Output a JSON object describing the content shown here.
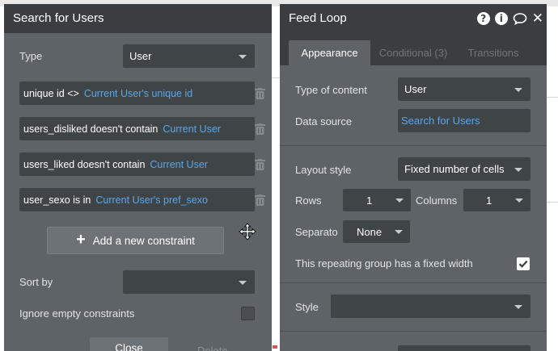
{
  "search_panel": {
    "title": "Search for Users",
    "type_label": "Type",
    "type_value": "User",
    "constraints": [
      {
        "field": "unique id <>",
        "value": "Current User's unique id"
      },
      {
        "field": "users_disliked doesn't contain",
        "value": "Current User"
      },
      {
        "field": "users_liked doesn't contain",
        "value": "Current User"
      },
      {
        "field": "user_sexo is in",
        "value": "Current User's pref_sexo"
      }
    ],
    "add_constraint_label": "Add a new constraint",
    "sort_by_label": "Sort by",
    "sort_by_value": "",
    "ignore_empty_label": "Ignore empty constraints",
    "close_label": "Close",
    "delete_label": "Delete"
  },
  "feed_panel": {
    "title": "Feed Loop",
    "tabs": [
      {
        "label": "Appearance",
        "active": true
      },
      {
        "label": "Conditional (3)",
        "active": false
      },
      {
        "label": "Transitions",
        "active": false
      }
    ],
    "type_of_content_label": "Type of content",
    "type_of_content_value": "User",
    "data_source_label": "Data source",
    "data_source_value": "Search for Users",
    "layout_style_label": "Layout style",
    "layout_style_value": "Fixed number of cells",
    "rows_label": "Rows",
    "rows_value": "1",
    "columns_label": "Columns",
    "columns_value": "1",
    "separator_label": "Separato",
    "separator_value": "None",
    "fixed_width_label": "This repeating group has a fixed width",
    "fixed_width_checked": true,
    "style_label": "Style",
    "style_value": ""
  },
  "colors": {
    "panel_bg": "#5d6367",
    "header_bg": "#3a3e41",
    "field_bg": "#3f4447",
    "link_blue": "#5aa6ea"
  },
  "icons": {
    "help": "help-icon",
    "info": "info-icon",
    "comment": "comment-icon",
    "close": "close-icon",
    "trash": "trash-icon",
    "move": "move-cursor-icon",
    "caret": "chevron-down-icon",
    "plus": "plus-icon"
  }
}
